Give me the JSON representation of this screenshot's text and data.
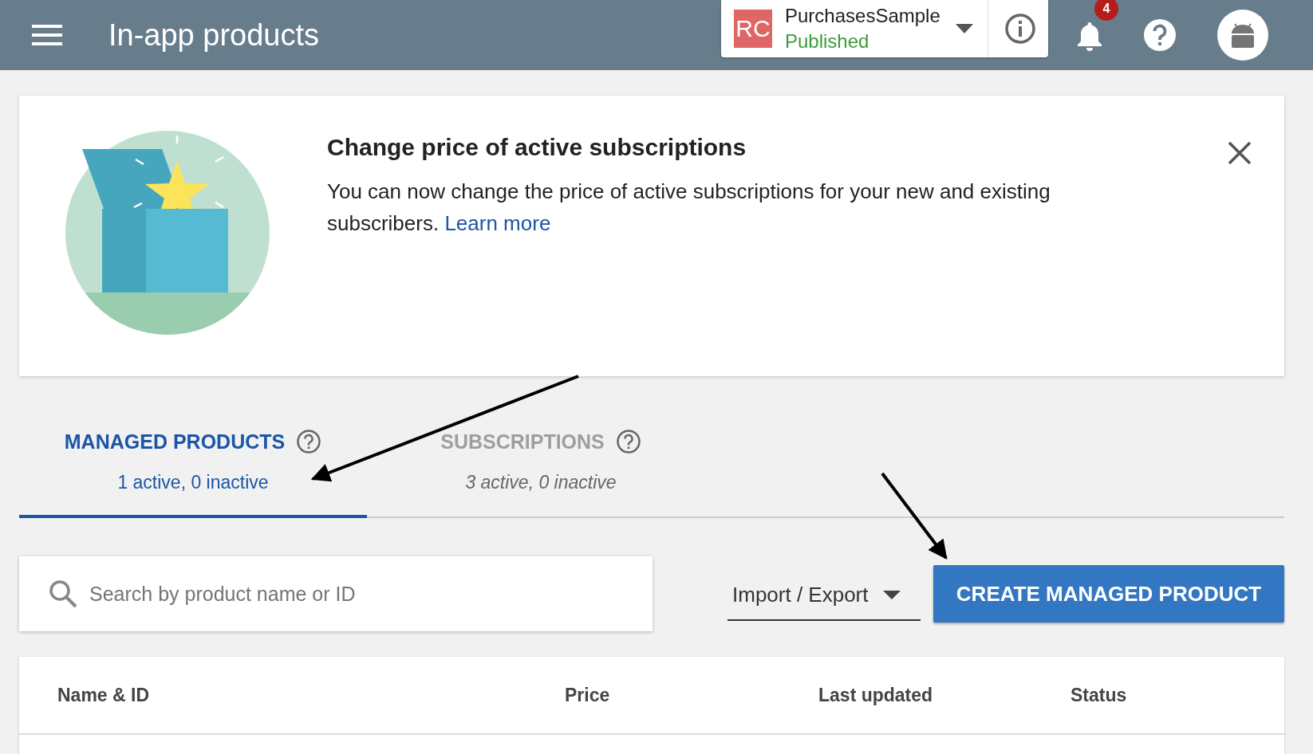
{
  "top_bar": {
    "title": "In-app products",
    "app": {
      "initials": "RC",
      "name": "PurchasesSample",
      "status": "Published"
    },
    "notification_count": "4"
  },
  "banner": {
    "title": "Change price of active subscriptions",
    "text": "You can now change the price of active subscriptions for your new and existing subscribers.",
    "link": "Learn more"
  },
  "tabs": [
    {
      "label": "MANAGED PRODUCTS",
      "summary": "1 active, 0 inactive",
      "selected": true
    },
    {
      "label": "SUBSCRIPTIONS",
      "summary": "3 active, 0 inactive",
      "selected": false
    }
  ],
  "search": {
    "placeholder": "Search by product name or ID"
  },
  "import_export": {
    "label": "Import / Export"
  },
  "create_button": {
    "label": "CREATE MANAGED PRODUCT"
  },
  "table": {
    "columns": [
      "Name & ID",
      "Price",
      "Last updated",
      "Status"
    ]
  }
}
